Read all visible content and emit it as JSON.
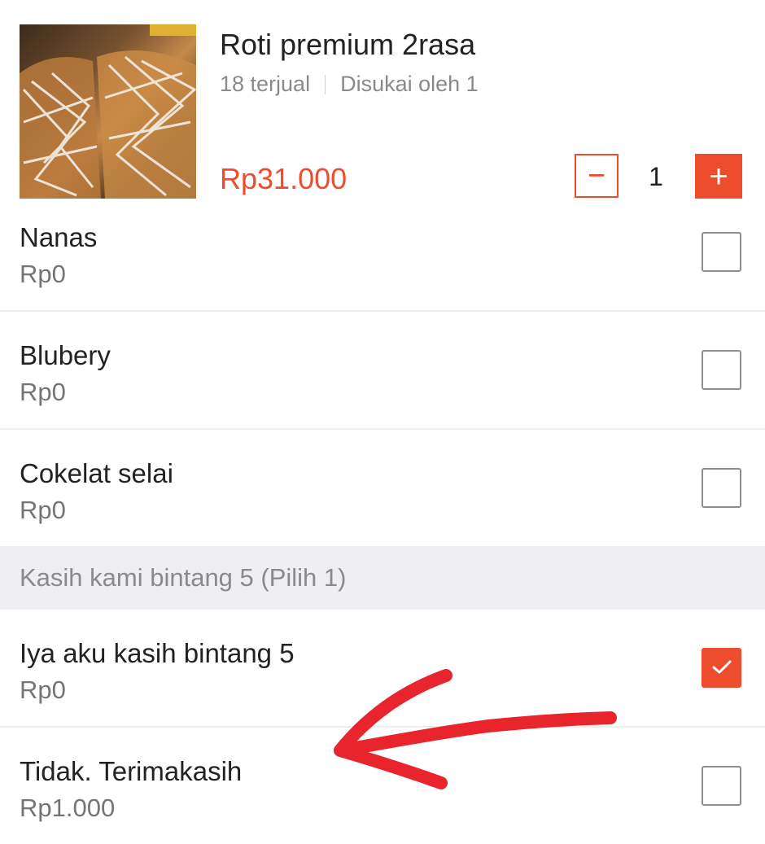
{
  "product": {
    "title": "Roti premium 2rasa",
    "sold": "18 terjual",
    "liked": "Disukai oleh 1",
    "price": "Rp31.000",
    "quantity": "1",
    "minus_symbol": "−",
    "plus_symbol": "+"
  },
  "options_top": [
    {
      "name": "Nanas",
      "price": "Rp0",
      "checked": false
    },
    {
      "name": "Blubery",
      "price": "Rp0",
      "checked": false
    },
    {
      "name": "Cokelat selai",
      "price": "Rp0",
      "checked": false
    }
  ],
  "section": {
    "title": "Kasih kami bintang 5 (Pilih 1)"
  },
  "options_bottom": [
    {
      "name": "Iya aku kasih bintang 5",
      "price": "Rp0",
      "checked": true
    },
    {
      "name": "Tidak. Terimakasih",
      "price": "Rp1.000",
      "checked": false
    }
  ],
  "colors": {
    "accent": "#ee4d2d",
    "annotation": "#e8242c"
  },
  "icons": {
    "minus": "minus-icon",
    "plus": "plus-icon",
    "check": "check-icon",
    "arrow": "hand-drawn-arrow"
  }
}
